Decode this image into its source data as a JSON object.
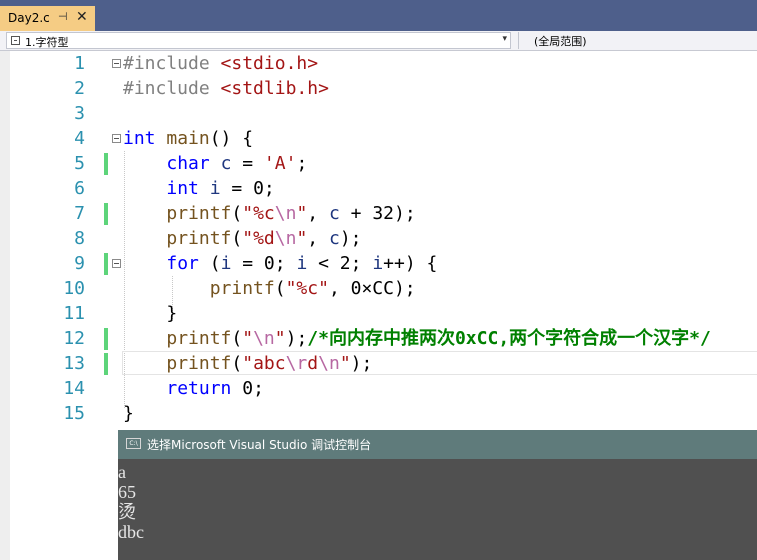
{
  "tab": {
    "title": "Day2.c",
    "pin_glyph": "⊣",
    "close_glyph": "✕",
    "accent": "#f5cc84"
  },
  "navbar": {
    "scope_left": "1.字符型",
    "scope_right": "(全局范围)"
  },
  "line_numbers": [
    "1",
    "2",
    "3",
    "4",
    "5",
    "6",
    "7",
    "8",
    "9",
    "10",
    "11",
    "12",
    "13",
    "14",
    "15"
  ],
  "code": {
    "l1": {
      "pp": "#include ",
      "hdr": "<stdio.h>"
    },
    "l2": {
      "pp": "#include ",
      "hdr": "<stdlib.h>"
    },
    "l4": {
      "kw": "int",
      "fn": "main",
      "rest": "() {"
    },
    "l5": {
      "indent": "    ",
      "kw": "char",
      "var": "c",
      "mid": " = ",
      "str": "'A'",
      "end": ";"
    },
    "l6": {
      "indent": "    ",
      "kw": "int",
      "var": "i",
      "mid": " = 0;"
    },
    "l7": {
      "indent": "    ",
      "fn": "printf",
      "open": "(",
      "s1": "\"%c",
      "esc": "\\n",
      "s2": "\"",
      "mid": ", ",
      "var": "c",
      "end": " + 32);"
    },
    "l8": {
      "indent": "    ",
      "fn": "printf",
      "open": "(",
      "s1": "\"%d",
      "esc": "\\n",
      "s2": "\"",
      "mid": ", ",
      "var": "c",
      "end": ");"
    },
    "l9": {
      "indent": "    ",
      "kw": "for",
      "p1": " (",
      "v1": "i",
      "p2": " = 0; ",
      "v2": "i",
      "p3": " < 2; ",
      "v3": "i",
      "p4": "++) {"
    },
    "l10": {
      "indent": "        ",
      "fn": "printf",
      "open": "(",
      "str": "\"%c\"",
      "end": ", 0×CC);"
    },
    "l11": {
      "indent": "    ",
      "text": "}"
    },
    "l12": {
      "indent": "    ",
      "fn": "printf",
      "open": "(",
      "s1": "\"",
      "esc": "\\n",
      "s2": "\"",
      "end": ");",
      "comment": "/*向内存中推两次0xCC,两个字符合成一个汉字*/"
    },
    "l13": {
      "indent": "    ",
      "fn": "printf",
      "open": "(",
      "s1": "\"abc",
      "esc1": "\\r",
      "s2": "d",
      "esc2": "\\n",
      "s3": "\"",
      "end": ");"
    },
    "l14": {
      "indent": "    ",
      "kw": "return",
      "end": " 0;"
    },
    "l15": {
      "text": "}"
    }
  },
  "console": {
    "title": "选择Microsoft Visual Studio 调试控制台",
    "icon_label": "C:\\",
    "output": [
      "a",
      "65",
      "烫",
      "dbc"
    ]
  },
  "colors": {
    "tabstrip": "#4e5f8b",
    "console_title": "#5f7b7b",
    "console_bg": "#505050",
    "change_bar": "#5dd47a"
  }
}
